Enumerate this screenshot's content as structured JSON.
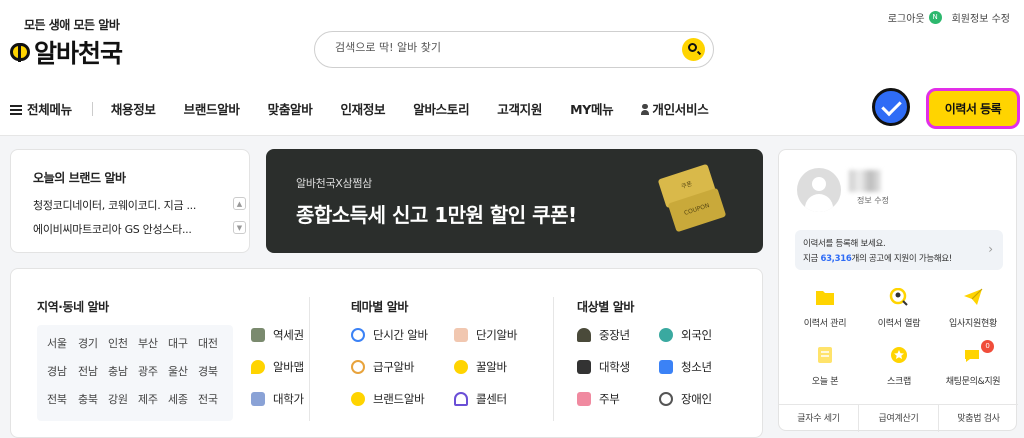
{
  "header": {
    "logo_sub": "모든 생애 모든 알바",
    "logo_main": "알바천국",
    "logout": "로그아웃",
    "new_badge": "N",
    "member_edit": "회원정보 수정",
    "search_placeholder": "검색으로 딱! 알바 찾기"
  },
  "nav": {
    "items": [
      "전체메뉴",
      "채용정보",
      "브랜드알바",
      "맞춤알바",
      "인재정보",
      "알바스토리",
      "고객지원",
      "MY메뉴",
      "개인서비스"
    ],
    "resume_button": "이력서 등록"
  },
  "brand": {
    "title": "오늘의 브랜드 알바",
    "rows": [
      "청정코디네이터, 코웨이코디. 지금 ...",
      "에이비씨마트코리아 GS 안성스타..."
    ]
  },
  "banner": {
    "subtitle": "알바천국X삼쩜삼",
    "headline": "종합소득세 신고 1만원 할인 쿠폰!",
    "ticket1": "쿠폰",
    "ticket2": "COUPON"
  },
  "profile": {
    "edit": "정보 수정",
    "resume_hint": "이력서를 등록해 보세요.",
    "resume_stat_prefix": "지금 ",
    "resume_stat_count": "63,316",
    "resume_stat_suffix": "개의 공고에 지원이 가능해요!",
    "icons": [
      {
        "label": "이력서 관리",
        "icon": "folder-icon"
      },
      {
        "label": "이력서 열람",
        "icon": "search-person-icon"
      },
      {
        "label": "입사지원현황",
        "icon": "paper-plane-icon"
      },
      {
        "label": "오늘 본",
        "icon": "document-icon"
      },
      {
        "label": "스크랩",
        "icon": "star-icon"
      },
      {
        "label": "채팅문의&지원",
        "icon": "chat-icon"
      }
    ],
    "chat_badge": "0",
    "bottom_links": [
      "글자수 세기",
      "급여계산기",
      "맞춤법 검사"
    ]
  },
  "categories": {
    "region_title": "지역·동네 알바",
    "regions": [
      [
        "서울",
        "경기",
        "인천",
        "부산",
        "대구",
        "대전"
      ],
      [
        "경남",
        "전남",
        "충남",
        "광주",
        "울산",
        "경북"
      ],
      [
        "전북",
        "충북",
        "강원",
        "제주",
        "세종",
        "전국"
      ]
    ],
    "region_extra": [
      "역세권",
      "알바맵",
      "대학가"
    ],
    "theme_title": "테마별 알바",
    "themes": [
      "단시간 알바",
      "단기알바",
      "급구알바",
      "꿀알바",
      "브랜드알바",
      "콜센터"
    ],
    "target_title": "대상별 알바",
    "targets": [
      "중장년",
      "외국인",
      "대학생",
      "청소년",
      "주부",
      "장애인"
    ]
  }
}
